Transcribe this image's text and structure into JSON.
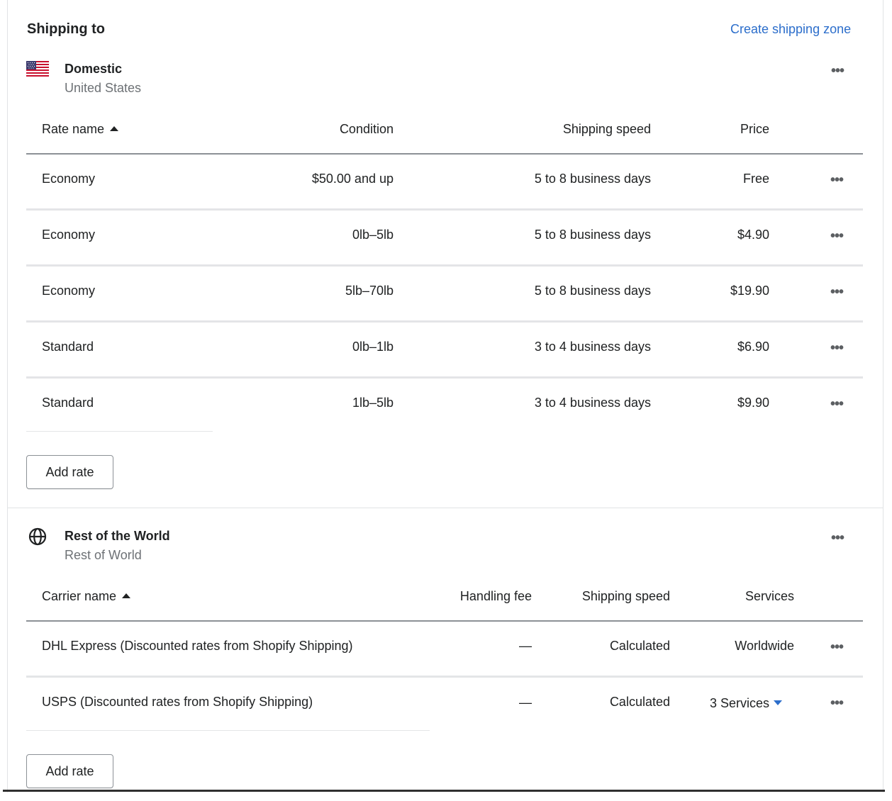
{
  "header": {
    "title": "Shipping to",
    "create_zone_label": "Create shipping zone"
  },
  "domestic": {
    "name": "Domestic",
    "country": "United States",
    "flag_icon": "us-flag-icon",
    "columns": {
      "rate_name": "Rate name",
      "condition": "Condition",
      "shipping_speed": "Shipping speed",
      "price": "Price"
    },
    "rows": [
      {
        "name": "Economy",
        "condition": "$50.00 and up",
        "speed": "5 to 8 business days",
        "price": "Free"
      },
      {
        "name": "Economy",
        "condition": "0lb–5lb",
        "speed": "5 to 8 business days",
        "price": "$4.90"
      },
      {
        "name": "Economy",
        "condition": "5lb–70lb",
        "speed": "5 to 8 business days",
        "price": "$19.90"
      },
      {
        "name": "Standard",
        "condition": "0lb–1lb",
        "speed": "3 to 4 business days",
        "price": "$6.90"
      },
      {
        "name": "Standard",
        "condition": "1lb–5lb",
        "speed": "3 to 4 business days",
        "price": "$9.90"
      }
    ],
    "add_rate_label": "Add rate"
  },
  "world": {
    "name": "Rest of the World",
    "region": "Rest of World",
    "globe_icon": "globe-icon",
    "columns": {
      "carrier_name": "Carrier name",
      "handling_fee": "Handling fee",
      "shipping_speed": "Shipping speed",
      "services": "Services"
    },
    "rows": [
      {
        "name": "DHL Express (Discounted rates from Shopify Shipping)",
        "fee": "—",
        "speed": "Calculated",
        "services": "Worldwide"
      },
      {
        "name": "USPS (Discounted rates from Shopify Shipping)",
        "fee": "—",
        "speed": "Calculated",
        "services": "3 Services"
      }
    ],
    "add_rate_label": "Add rate"
  },
  "more_icon": "•••",
  "colors": {
    "accent": "#2c6ecb",
    "text": "#202223",
    "subdued": "#6d7175"
  }
}
